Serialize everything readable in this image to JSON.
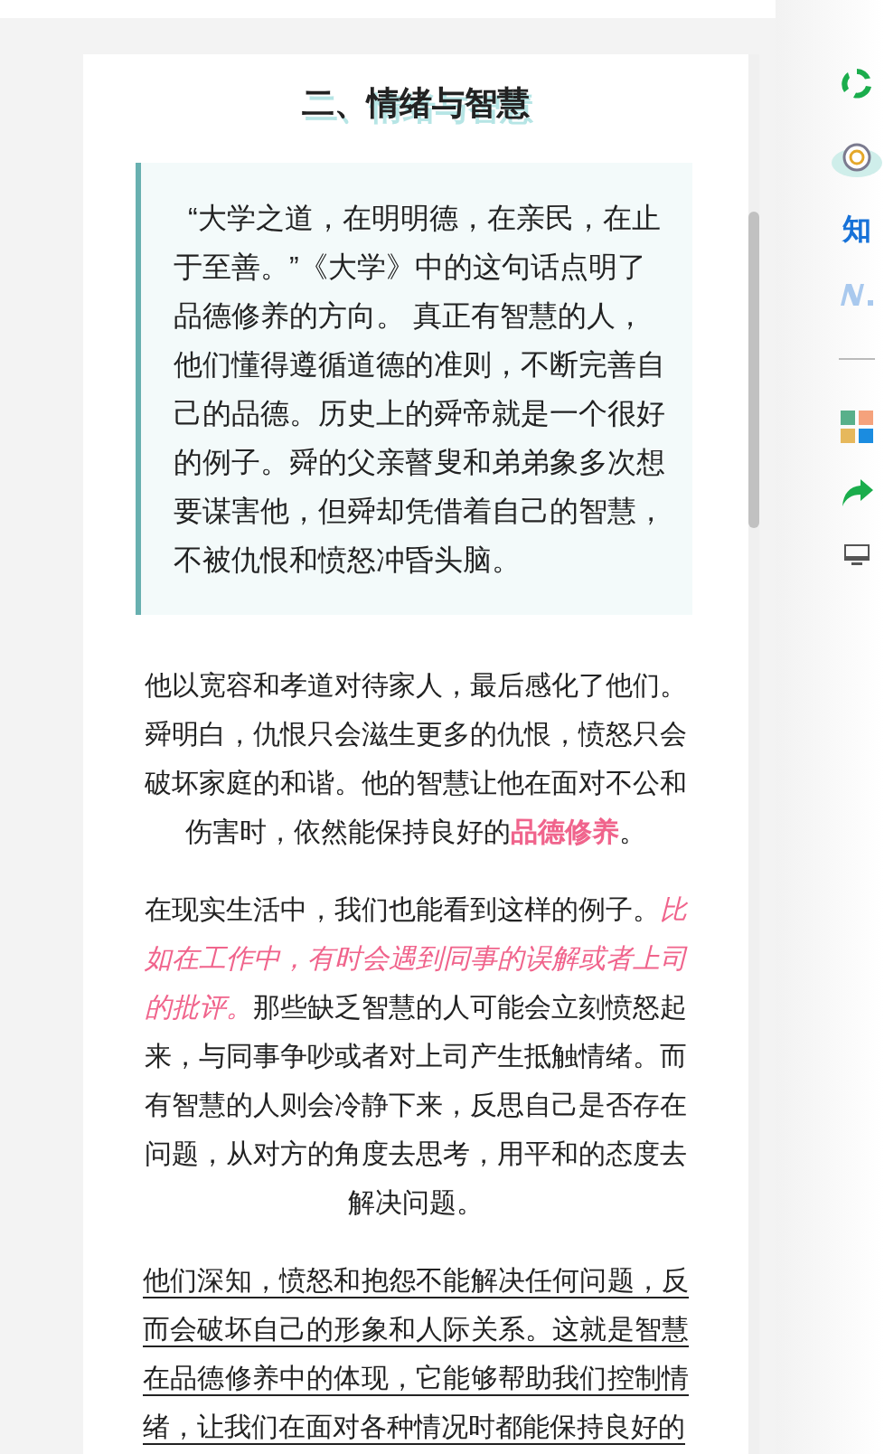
{
  "article": {
    "heading": "二、情绪与智慧",
    "quote": "“大学之道，在明明德，在亲民，在止于至善。”《大学》中的这句话点明了品德修养的方向。 真正有智慧的人，他们懂得遵循道德的准则，不断完善自己的品德。历史上的舜帝就是一个很好的例子。舜的父亲瞽叟和弟弟象多次想要谋害他，但舜却凭借着自己的智慧，不被仇恨和愤怒冲昏头脑。",
    "paragraphs": [
      {
        "underline": false,
        "segments": [
          {
            "kind": "plain",
            "text": "他以宽容和孝道对待家人，最后感化了他们。舜明白，仇恨只会滋生更多的仇恨，愤怒只会破坏家庭的和谐。他的智慧让他在面对不公和伤害时，依然能保持良好的"
          },
          {
            "kind": "highlight",
            "text": "品德修养"
          },
          {
            "kind": "plain",
            "text": "。"
          }
        ]
      },
      {
        "underline": false,
        "segments": [
          {
            "kind": "plain",
            "text": "在现实生活中，我们也能看到这样的例子。"
          },
          {
            "kind": "italic",
            "text": "比如在工作中，有时会遇到同事的误解或者上司的批评。"
          },
          {
            "kind": "plain",
            "text": "那些缺乏智慧的人可能会立刻愤怒起来，与同事争吵或者对上司产生抵触情绪。而有智慧的人则会冷静下来，反思自己是否存在问题，从对方的角度去思考，用平和的态度去解决问题。"
          }
        ]
      },
      {
        "underline": true,
        "segments": [
          {
            "kind": "plain",
            "text": "他们深知，愤怒和抱怨不能解决任何问题，反而会破坏自己的形象和人际关系。这就是智慧在品德修养中的体现，它能够帮助我们控制情绪，让我们在面对各种情况时都能保持良好的"
          }
        ]
      }
    ]
  },
  "sidebar": {
    "items": [
      {
        "kind": "recycle"
      },
      {
        "kind": "cloud"
      },
      {
        "kind": "text",
        "text": "知"
      },
      {
        "kind": "n-logo"
      },
      {
        "kind": "divider"
      },
      {
        "kind": "grid"
      },
      {
        "kind": "share"
      },
      {
        "kind": "monitor"
      }
    ]
  }
}
